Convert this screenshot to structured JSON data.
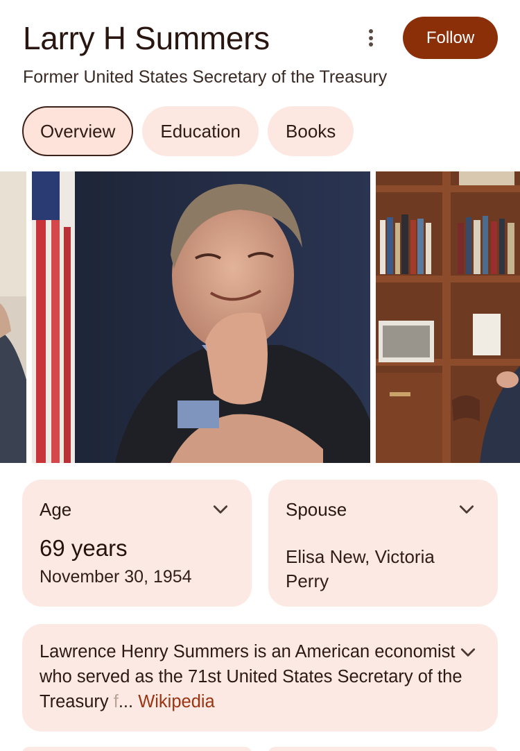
{
  "header": {
    "title": "Larry H Summers",
    "follow_label": "Follow",
    "subtitle": "Former United States Secretary of the Treasury"
  },
  "tabs": [
    {
      "label": "Overview",
      "active": true
    },
    {
      "label": "Education",
      "active": false
    },
    {
      "label": "Books",
      "active": false
    }
  ],
  "facts": {
    "age": {
      "label": "Age",
      "value": "69 years",
      "detail": "November 30, 1954"
    },
    "spouse": {
      "label": "Spouse",
      "value": "Elisa New, Victoria Perry"
    }
  },
  "description": {
    "text": "Lawrence Henry Summers is an American economist who served as the 71st United States Secretary of the Treasury ",
    "faded": "f",
    "ellipsis": "... ",
    "source": "Wikipedia"
  },
  "colors": {
    "accent": "#8a2f08",
    "card_bg": "#fde9e3",
    "link": "#9a3412"
  }
}
